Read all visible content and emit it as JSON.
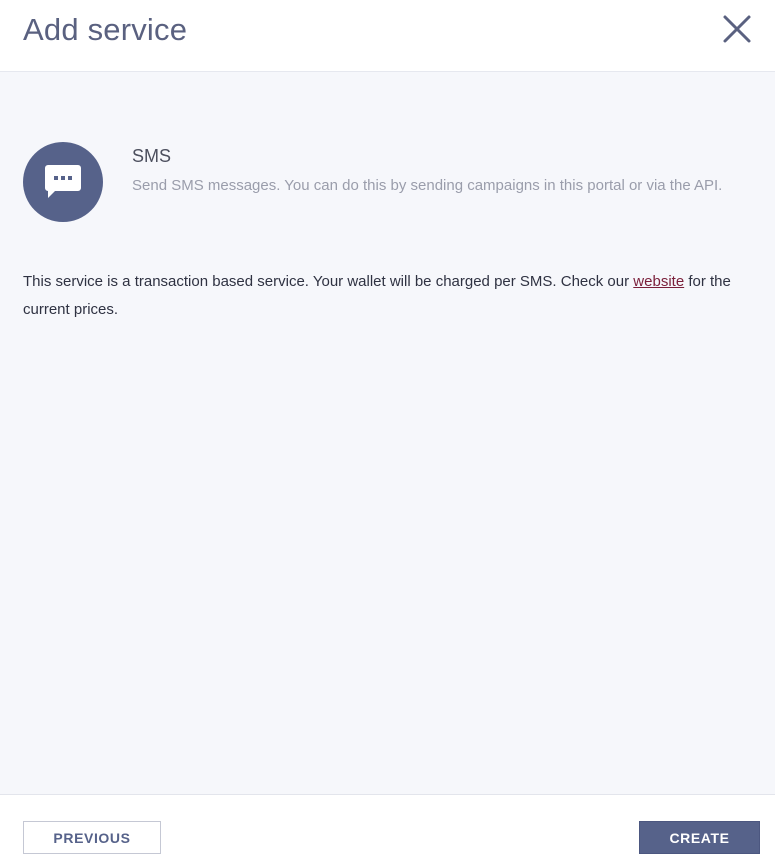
{
  "header": {
    "title": "Add service"
  },
  "service": {
    "icon": "chat-bubble-icon",
    "name": "SMS",
    "description": "Send SMS messages. You can do this by sending campaigns in this portal or via the API."
  },
  "info": {
    "text_before": "This service is a transaction based service. Your wallet will be charged per SMS. Check our ",
    "link_label": "website",
    "text_after": " for the current prices."
  },
  "footer": {
    "previous_label": "PREVIOUS",
    "create_label": "CREATE"
  },
  "colors": {
    "accent": "#56628a",
    "link": "#7a1f3a",
    "body_bg": "#f6f7fb"
  }
}
